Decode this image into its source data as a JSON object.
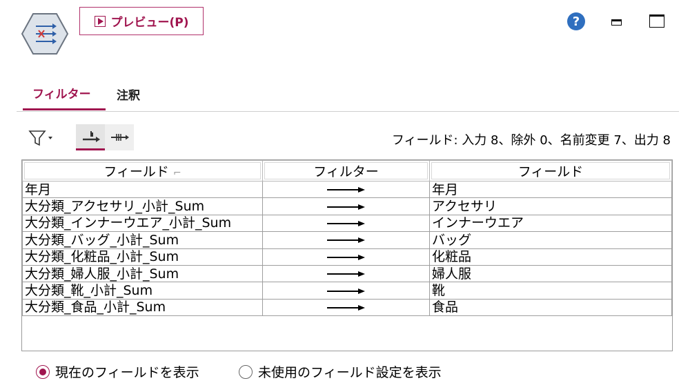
{
  "toolbar": {
    "preview_label": "プレビュー(P)",
    "help_label": "?"
  },
  "tabs": [
    {
      "label": "フィルター",
      "active": true
    },
    {
      "label": "注釈",
      "active": false
    }
  ],
  "summary": "フィールド: 入力 8、除外 0、名前変更 7、出力 8",
  "table": {
    "headers": [
      "フィールド",
      "フィルター",
      "フィールド"
    ],
    "rows": [
      {
        "input": "年月",
        "output": "年月"
      },
      {
        "input": "大分類_アクセサリ_小計_Sum",
        "output": "アクセサリ"
      },
      {
        "input": "大分類_インナーウエア_小計_Sum",
        "output": "インナーウエア"
      },
      {
        "input": "大分類_バッグ_小計_Sum",
        "output": "バッグ"
      },
      {
        "input": "大分類_化粧品_小計_Sum",
        "output": "化粧品"
      },
      {
        "input": "大分類_婦人服_小計_Sum",
        "output": "婦人服"
      },
      {
        "input": "大分類_靴_小計_Sum",
        "output": "靴"
      },
      {
        "input": "大分類_食品_小計_Sum",
        "output": "食品"
      }
    ]
  },
  "radios": [
    {
      "label": "現在のフィールドを表示",
      "checked": true
    },
    {
      "label": "未使用のフィールド設定を表示",
      "checked": false
    }
  ],
  "colors": {
    "accent": "#a0154f",
    "help": "#2f6fbf"
  },
  "icons": {
    "node": "filter-node-icon",
    "preview": "play-icon",
    "filter_menu": "funnel-icon",
    "pass_all": "pass-fields-icon",
    "remove_all": "discard-fields-icon",
    "row_arrow": "arrow-right-icon"
  }
}
